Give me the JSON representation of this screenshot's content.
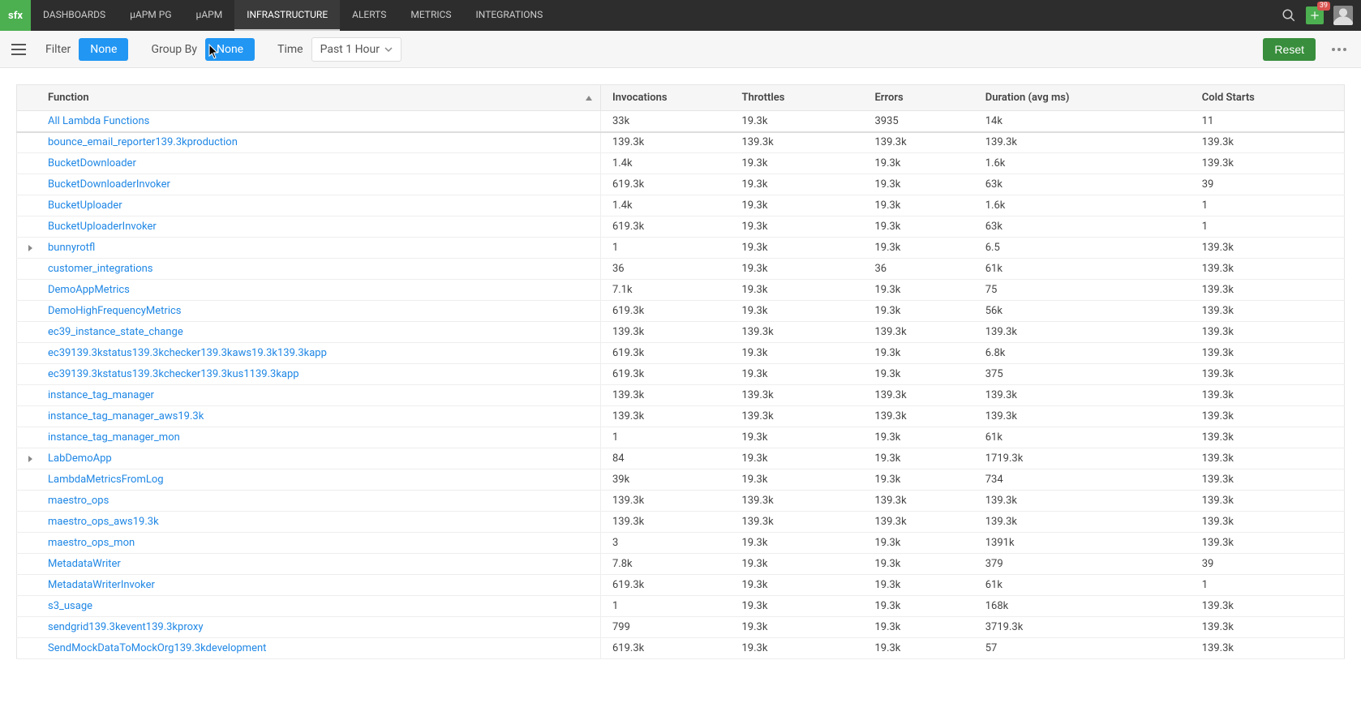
{
  "brand": "sfx",
  "nav": {
    "items": [
      "DASHBOARDS",
      "µAPM PG",
      "µAPM",
      "INFRASTRUCTURE",
      "ALERTS",
      "METRICS",
      "INTEGRATIONS"
    ],
    "activeIndex": 3
  },
  "badge_count": "39",
  "filterbar": {
    "filter_label": "Filter",
    "filter_value": "None",
    "groupby_label": "Group By",
    "groupby_value": "None",
    "time_label": "Time",
    "time_value": "Past 1 Hour",
    "reset_label": "Reset"
  },
  "table": {
    "columns": [
      "Function",
      "Invocations",
      "Throttles",
      "Errors",
      "Duration (avg ms)",
      "Cold Starts"
    ],
    "rows": [
      {
        "func": "All Lambda Functions",
        "inv": "33k",
        "thr": "19.3k",
        "err": "3935",
        "dur": "14k",
        "cold": "11",
        "expand": false
      },
      {
        "func": "bounce_email_reporter139.3kproduction",
        "inv": "139.3k",
        "thr": "139.3k",
        "err": "139.3k",
        "dur": "139.3k",
        "cold": "139.3k",
        "expand": false
      },
      {
        "func": "BucketDownloader",
        "inv": "1.4k",
        "thr": "19.3k",
        "err": "19.3k",
        "dur": "1.6k",
        "cold": "139.3k",
        "expand": false
      },
      {
        "func": "BucketDownloaderInvoker",
        "inv": "619.3k",
        "thr": "19.3k",
        "err": "19.3k",
        "dur": "63k",
        "cold": "39",
        "expand": false
      },
      {
        "func": "BucketUploader",
        "inv": "1.4k",
        "thr": "19.3k",
        "err": "19.3k",
        "dur": "1.6k",
        "cold": "1",
        "expand": false
      },
      {
        "func": "BucketUploaderInvoker",
        "inv": "619.3k",
        "thr": "19.3k",
        "err": "19.3k",
        "dur": "63k",
        "cold": "1",
        "expand": false
      },
      {
        "func": "bunnyrotfl",
        "inv": "1",
        "thr": "19.3k",
        "err": "19.3k",
        "dur": "6.5",
        "cold": "139.3k",
        "expand": true
      },
      {
        "func": "customer_integrations",
        "inv": "36",
        "thr": "19.3k",
        "err": "36",
        "dur": "61k",
        "cold": "139.3k",
        "expand": false
      },
      {
        "func": "DemoAppMetrics",
        "inv": "7.1k",
        "thr": "19.3k",
        "err": "19.3k",
        "dur": "75",
        "cold": "139.3k",
        "expand": false
      },
      {
        "func": "DemoHighFrequencyMetrics",
        "inv": "619.3k",
        "thr": "19.3k",
        "err": "19.3k",
        "dur": "56k",
        "cold": "139.3k",
        "expand": false
      },
      {
        "func": "ec39_instance_state_change",
        "inv": "139.3k",
        "thr": "139.3k",
        "err": "139.3k",
        "dur": "139.3k",
        "cold": "139.3k",
        "expand": false
      },
      {
        "func": "ec39139.3kstatus139.3kchecker139.3kaws19.3k139.3kapp",
        "inv": "619.3k",
        "thr": "19.3k",
        "err": "19.3k",
        "dur": "6.8k",
        "cold": "139.3k",
        "expand": false
      },
      {
        "func": "ec39139.3kstatus139.3kchecker139.3kus1139.3kapp",
        "inv": "619.3k",
        "thr": "19.3k",
        "err": "19.3k",
        "dur": "375",
        "cold": "139.3k",
        "expand": false
      },
      {
        "func": "instance_tag_manager",
        "inv": "139.3k",
        "thr": "139.3k",
        "err": "139.3k",
        "dur": "139.3k",
        "cold": "139.3k",
        "expand": false
      },
      {
        "func": "instance_tag_manager_aws19.3k",
        "inv": "139.3k",
        "thr": "139.3k",
        "err": "139.3k",
        "dur": "139.3k",
        "cold": "139.3k",
        "expand": false
      },
      {
        "func": "instance_tag_manager_mon",
        "inv": "1",
        "thr": "19.3k",
        "err": "19.3k",
        "dur": "61k",
        "cold": "139.3k",
        "expand": false
      },
      {
        "func": "LabDemoApp",
        "inv": "84",
        "thr": "19.3k",
        "err": "19.3k",
        "dur": "1719.3k",
        "cold": "139.3k",
        "expand": true
      },
      {
        "func": "LambdaMetricsFromLog",
        "inv": "39k",
        "thr": "19.3k",
        "err": "19.3k",
        "dur": "734",
        "cold": "139.3k",
        "expand": false
      },
      {
        "func": "maestro_ops",
        "inv": "139.3k",
        "thr": "139.3k",
        "err": "139.3k",
        "dur": "139.3k",
        "cold": "139.3k",
        "expand": false
      },
      {
        "func": "maestro_ops_aws19.3k",
        "inv": "139.3k",
        "thr": "139.3k",
        "err": "139.3k",
        "dur": "139.3k",
        "cold": "139.3k",
        "expand": false
      },
      {
        "func": "maestro_ops_mon",
        "inv": "3",
        "thr": "19.3k",
        "err": "19.3k",
        "dur": "1391k",
        "cold": "139.3k",
        "expand": false
      },
      {
        "func": "MetadataWriter",
        "inv": "7.8k",
        "thr": "19.3k",
        "err": "19.3k",
        "dur": "379",
        "cold": "39",
        "expand": false
      },
      {
        "func": "MetadataWriterInvoker",
        "inv": "619.3k",
        "thr": "19.3k",
        "err": "19.3k",
        "dur": "61k",
        "cold": "1",
        "expand": false
      },
      {
        "func": "s3_usage",
        "inv": "1",
        "thr": "19.3k",
        "err": "19.3k",
        "dur": "168k",
        "cold": "139.3k",
        "expand": false
      },
      {
        "func": "sendgrid139.3kevent139.3kproxy",
        "inv": "799",
        "thr": "19.3k",
        "err": "19.3k",
        "dur": "3719.3k",
        "cold": "139.3k",
        "expand": false
      },
      {
        "func": "SendMockDataToMockOrg139.3kdevelopment",
        "inv": "619.3k",
        "thr": "19.3k",
        "err": "19.3k",
        "dur": "57",
        "cold": "139.3k",
        "expand": false
      }
    ]
  }
}
